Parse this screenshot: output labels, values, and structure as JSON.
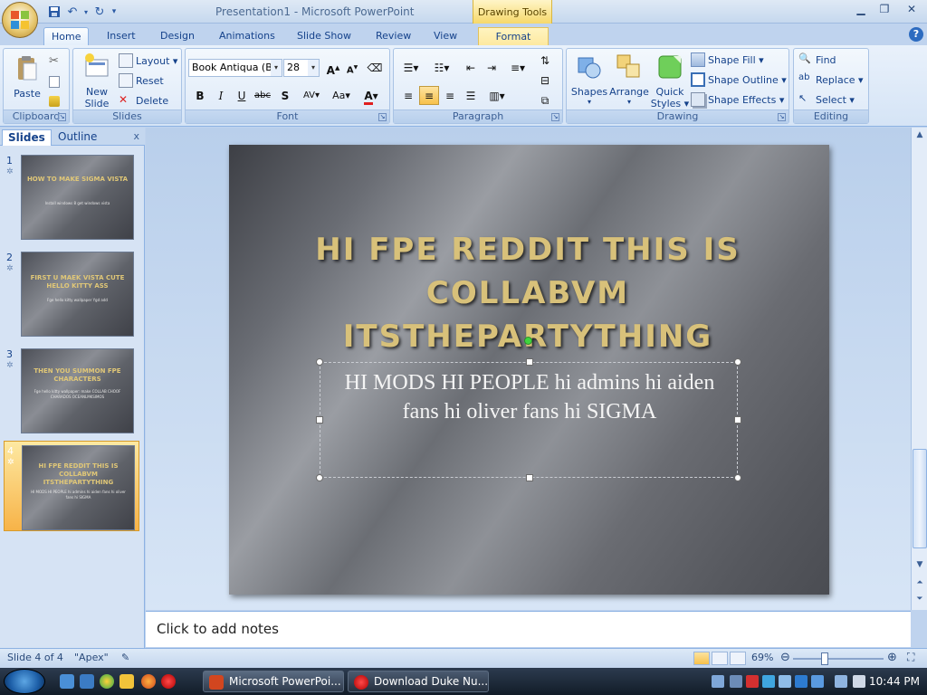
{
  "window": {
    "title": "Presentation1 - Microsoft PowerPoint",
    "contextual_tab_group": "Drawing Tools"
  },
  "tabs": [
    {
      "label": "Home",
      "active": true
    },
    {
      "label": "Insert"
    },
    {
      "label": "Design"
    },
    {
      "label": "Animations"
    },
    {
      "label": "Slide Show"
    },
    {
      "label": "Review"
    },
    {
      "label": "View"
    },
    {
      "label": "Format",
      "contextual": true
    }
  ],
  "ribbon": {
    "clipboard": {
      "label": "Clipboard",
      "paste": "Paste"
    },
    "slides": {
      "label": "Slides",
      "new_slide": "New",
      "new_slide2": "Slide",
      "layout": "Layout",
      "reset": "Reset",
      "delete": "Delete"
    },
    "font": {
      "label": "Font",
      "font_name": "Book Antiqua (Bo",
      "font_size": "28",
      "bold": "B",
      "italic": "I",
      "underline": "U",
      "strike": "abc",
      "shadow": "S",
      "spacing": "AV",
      "case": "Aa",
      "color": "A"
    },
    "paragraph": {
      "label": "Paragraph"
    },
    "drawing": {
      "label": "Drawing",
      "shapes": "Shapes",
      "arrange": "Arrange",
      "quick_styles": "Quick",
      "quick_styles2": "Styles",
      "shape_fill": "Shape Fill",
      "shape_outline": "Shape Outline",
      "shape_effects": "Shape Effects"
    },
    "editing": {
      "label": "Editing",
      "find": "Find",
      "replace": "Replace",
      "select": "Select"
    }
  },
  "pane": {
    "tab_slides": "Slides",
    "tab_outline": "Outline",
    "close": "x",
    "slides": [
      {
        "num": "1",
        "title": "HOW TO MAKE SIGMA VISTA",
        "body": "Install windows 8 get windows vista",
        "selected": false
      },
      {
        "num": "2",
        "title": "FIRST U MAEK VISTA CUTE HELLO KITTY ASS",
        "body": "Fge hello kitty wallpaper Ygd add",
        "selected": false
      },
      {
        "num": "3",
        "title": "THEN YOU SUMMON FPE CHARACTERS",
        "body": "Fge hello kitty wallpaper: make COLLAB CHOOF CHARADOS OCEANLMKSIMOS",
        "selected": false
      },
      {
        "num": "4",
        "title": "HI FPE REDDIT THIS IS COLLABVM ITSTHEPARTYTHING",
        "body": "HI MODS HI PEOPLE hi admins hi aiden fans hi oliver fans hi SIGMA",
        "selected": true
      }
    ]
  },
  "slide": {
    "title": "HI FPE REDDIT THIS IS COLLABVM ITSTHEPARTYTHING",
    "body": "HI MODS HI PEOPLE hi admins hi aiden fans hi oliver fans hi SIGMA"
  },
  "notes": {
    "placeholder": "Click to add notes"
  },
  "status": {
    "slide_of": "Slide 4 of 4",
    "theme": "\"Apex\"",
    "zoom": "69%",
    "zoom_fraction": 0.69
  },
  "taskbar": {
    "buttons": [
      {
        "label": "Microsoft PowerPoi..."
      },
      {
        "label": "Download Duke Nu..."
      }
    ],
    "clock": "10:44 PM"
  },
  "colors": {
    "accent": "#15428b",
    "slide_title": "#d8c17a",
    "selected_thumb": "#f7b348"
  }
}
